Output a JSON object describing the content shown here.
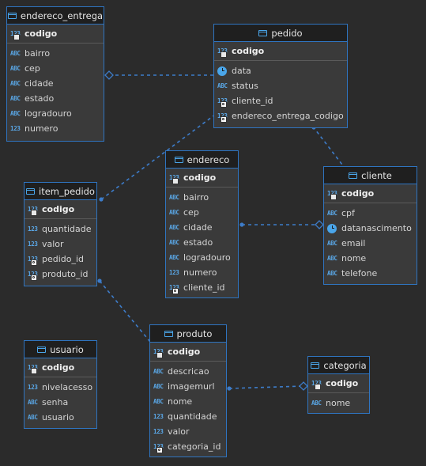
{
  "colors": {
    "background": "#2b2b2b",
    "entity_border": "#2f74c0",
    "link": "#3d7cc9",
    "type_icon": "#5aa8e8"
  },
  "entities": {
    "endereco_entrega": {
      "title": "endereco_entrega",
      "pk": {
        "type": "123",
        "name": "codigo"
      },
      "columns": [
        {
          "type": "ABC",
          "name": "bairro",
          "fk": false
        },
        {
          "type": "ABC",
          "name": "cep",
          "fk": false
        },
        {
          "type": "ABC",
          "name": "cidade",
          "fk": false
        },
        {
          "type": "ABC",
          "name": "estado",
          "fk": false
        },
        {
          "type": "ABC",
          "name": "logradouro",
          "fk": false
        },
        {
          "type": "123",
          "name": "numero",
          "fk": false
        }
      ]
    },
    "pedido": {
      "title": "pedido",
      "pk": {
        "type": "123",
        "name": "codigo"
      },
      "columns": [
        {
          "type": "clock",
          "name": "data",
          "fk": false
        },
        {
          "type": "ABC",
          "name": "status",
          "fk": false
        },
        {
          "type": "123",
          "name": "cliente_id",
          "fk": true
        },
        {
          "type": "123",
          "name": "endereco_entrega_codigo",
          "fk": true
        }
      ]
    },
    "endereco": {
      "title": "endereco",
      "pk": {
        "type": "123",
        "name": "codigo"
      },
      "columns": [
        {
          "type": "ABC",
          "name": "bairro",
          "fk": false
        },
        {
          "type": "ABC",
          "name": "cep",
          "fk": false
        },
        {
          "type": "ABC",
          "name": "cidade",
          "fk": false
        },
        {
          "type": "ABC",
          "name": "estado",
          "fk": false
        },
        {
          "type": "ABC",
          "name": "logradouro",
          "fk": false
        },
        {
          "type": "123",
          "name": "numero",
          "fk": false
        },
        {
          "type": "123",
          "name": "cliente_id",
          "fk": true
        }
      ]
    },
    "cliente": {
      "title": "cliente",
      "pk": {
        "type": "123",
        "name": "codigo"
      },
      "columns": [
        {
          "type": "ABC",
          "name": "cpf",
          "fk": false
        },
        {
          "type": "clock",
          "name": "datanascimento",
          "fk": false
        },
        {
          "type": "ABC",
          "name": "email",
          "fk": false
        },
        {
          "type": "ABC",
          "name": "nome",
          "fk": false
        },
        {
          "type": "ABC",
          "name": "telefone",
          "fk": false
        }
      ]
    },
    "item_pedido": {
      "title": "item_pedido",
      "pk": {
        "type": "123",
        "name": "codigo"
      },
      "columns": [
        {
          "type": "123",
          "name": "quantidade",
          "fk": false
        },
        {
          "type": "123",
          "name": "valor",
          "fk": false
        },
        {
          "type": "123",
          "name": "pedido_id",
          "fk": true
        },
        {
          "type": "123",
          "name": "produto_id",
          "fk": true
        }
      ]
    },
    "usuario": {
      "title": "usuario",
      "pk": {
        "type": "123",
        "name": "codigo"
      },
      "columns": [
        {
          "type": "123",
          "name": "nivelacesso",
          "fk": false
        },
        {
          "type": "ABC",
          "name": "senha",
          "fk": false
        },
        {
          "type": "ABC",
          "name": "usuario",
          "fk": false
        }
      ]
    },
    "produto": {
      "title": "produto",
      "pk": {
        "type": "123",
        "name": "codigo"
      },
      "columns": [
        {
          "type": "ABC",
          "name": "descricao",
          "fk": false
        },
        {
          "type": "ABC",
          "name": "imagemurl",
          "fk": false
        },
        {
          "type": "ABC",
          "name": "nome",
          "fk": false
        },
        {
          "type": "123",
          "name": "quantidade",
          "fk": false
        },
        {
          "type": "123",
          "name": "valor",
          "fk": false
        },
        {
          "type": "123",
          "name": "categoria_id",
          "fk": true
        }
      ]
    },
    "categoria": {
      "title": "categoria",
      "pk": {
        "type": "123",
        "name": "codigo"
      },
      "columns": [
        {
          "type": "ABC",
          "name": "nome",
          "fk": false
        }
      ]
    }
  }
}
